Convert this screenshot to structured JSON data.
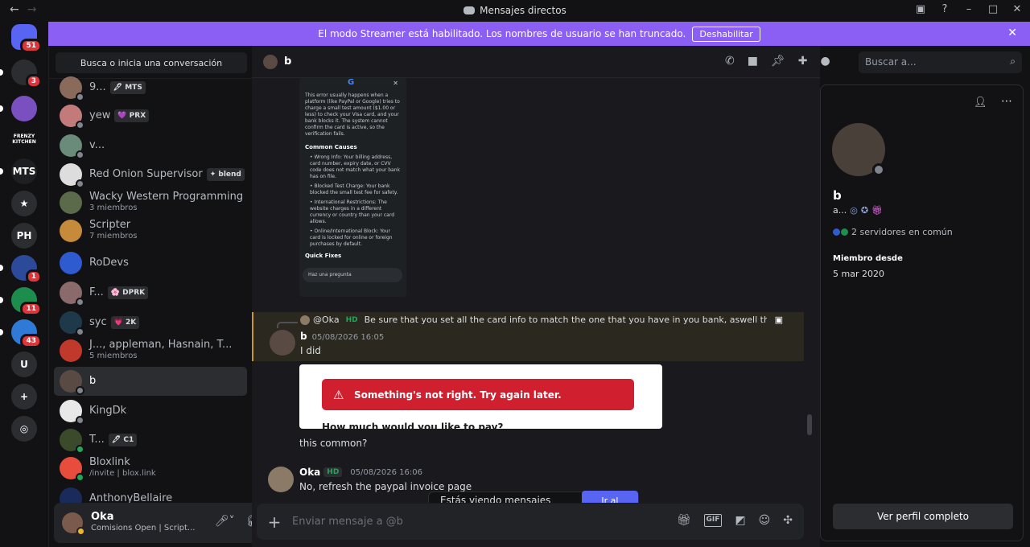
{
  "window": {
    "title": "Mensajes directos"
  },
  "banner": {
    "text": "El modo Streamer está habilitado. Los nombres de usuario se han truncado.",
    "button": "Deshabilitar"
  },
  "guilds": [
    {
      "label": "",
      "badge": "51",
      "color": "#5865f2"
    },
    {
      "label": "",
      "badge": "3",
      "color": "#2b2d31"
    },
    {
      "label": "",
      "badge": "",
      "color": "#7a4fc0"
    },
    {
      "label": "FRENZY KITCHEN",
      "badge": "",
      "color": "#121214"
    },
    {
      "label": "MTS",
      "badge": "",
      "color": "#1e1f22"
    },
    {
      "label": "★",
      "badge": "",
      "color": "#2b2d31"
    },
    {
      "label": "PH",
      "badge": "",
      "color": "#2b2d31"
    },
    {
      "label": "",
      "badge": "1",
      "color": "#2c4a9a"
    },
    {
      "label": "",
      "badge": "11",
      "color": "#1c8d4d"
    },
    {
      "label": "",
      "badge": "43",
      "color": "#2f7ad6"
    },
    {
      "label": "U",
      "badge": "",
      "color": "#2b2d31"
    }
  ],
  "dm_search": "Busca o inicia una conversación",
  "dms": [
    {
      "name": "9...",
      "tag": "🖋 MTS",
      "sub": "",
      "status": "off",
      "color": "#8a6a5a"
    },
    {
      "name": "yew",
      "tag": "💜 PRX",
      "sub": "",
      "status": "off",
      "color": "#c27a7a"
    },
    {
      "name": "v...",
      "tag": "",
      "sub": "",
      "status": "off",
      "color": "#6a8a7a"
    },
    {
      "name": "Red Onion Supervisor",
      "tag": "✦ blend",
      "sub": "",
      "status": "off",
      "color": "#dddddd"
    },
    {
      "name": "Wacky Western Programming",
      "tag": "",
      "sub": "3 miembros",
      "status": "",
      "color": "#5a6a4a"
    },
    {
      "name": "Scripter",
      "tag": "",
      "sub": "7 miembros",
      "status": "",
      "color": "#c58a3a"
    },
    {
      "name": "RoDevs",
      "tag": "",
      "sub": "",
      "status": "",
      "color": "#2e5bd0"
    },
    {
      "name": "F...",
      "tag": "🌸 DPRK",
      "sub": "",
      "status": "off",
      "color": "#8a6a6a"
    },
    {
      "name": "syc",
      "tag": "💗 2K",
      "sub": "",
      "status": "off",
      "color": "#1e3a4a"
    },
    {
      "name": "J..., appleman, Hasnain, T...",
      "tag": "",
      "sub": "5 miembros",
      "status": "",
      "color": "#c0392b"
    },
    {
      "name": "b",
      "tag": "",
      "sub": "",
      "status": "off",
      "color": "#5a4a44"
    },
    {
      "name": "KingDk",
      "tag": "",
      "sub": "",
      "status": "off",
      "color": "#e8e8e8"
    },
    {
      "name": "T...",
      "tag": "🖋 C1",
      "sub": "",
      "status": "on",
      "color": "#3a4a2a"
    },
    {
      "name": "Bloxlink",
      "tag": "",
      "sub": "/invite | blox.link",
      "status": "on",
      "color": "#e74c3c"
    },
    {
      "name": "AnthonyBellaire",
      "tag": "",
      "sub": "",
      "status": "",
      "color": "#1a2a5a"
    }
  ],
  "user": {
    "name": "Oka",
    "status": "Comisions Open | Script..."
  },
  "chat": {
    "recipient": "b",
    "phone_screenshot": {
      "intro": "This error usually happens when a platform (like PayPal or Google) tries to charge a small test amount ($1.00 or less) to check your Visa card, and your bank blocks it. The system cannot confirm the card is active, so the verification fails.",
      "heading1": "Common Causes",
      "causes": [
        "Wrong Info: Your billing address, card number, expiry date, or CVV code does not match what your bank has on file.",
        "Blocked Test Charge: Your bank blocked the small test fee for safety.",
        "International Restrictions: The website charges in a different currency or country than your card allows.",
        "Online/International Block: Your card is locked for online or foreign purchases by default."
      ],
      "heading2": "Quick Fixes",
      "ask_placeholder": "Haz una pregunta"
    },
    "reply": {
      "author": "@Oka",
      "badge": "HD",
      "text": "Be sure that you set all the card info to match the one that you have in you bank, aswell that you ba..."
    },
    "msg1": {
      "author": "b",
      "time": "05/08/2026 16:05",
      "text": "I did"
    },
    "error_card": {
      "text": "Something's not right. Try again later.",
      "below": "How much would you like to pay?"
    },
    "msg1b": "this common?",
    "msg2": {
      "author": "Oka",
      "badge": "HD",
      "time": "05/08/2026 16:06",
      "text": "No, refresh the paypal invoice page"
    },
    "toast": {
      "text": "Estás viendo mensajes antiguos",
      "button": "Ir al actual"
    },
    "composer_placeholder": "Enviar mensaje a @b"
  },
  "search_placeholder": "Buscar a...",
  "profile": {
    "name": "b",
    "sub": "a...",
    "mutual": "2 servidores en común",
    "member_since_label": "Miembro desde",
    "member_since": "5 mar 2020",
    "full_profile_button": "Ver perfil completo"
  }
}
